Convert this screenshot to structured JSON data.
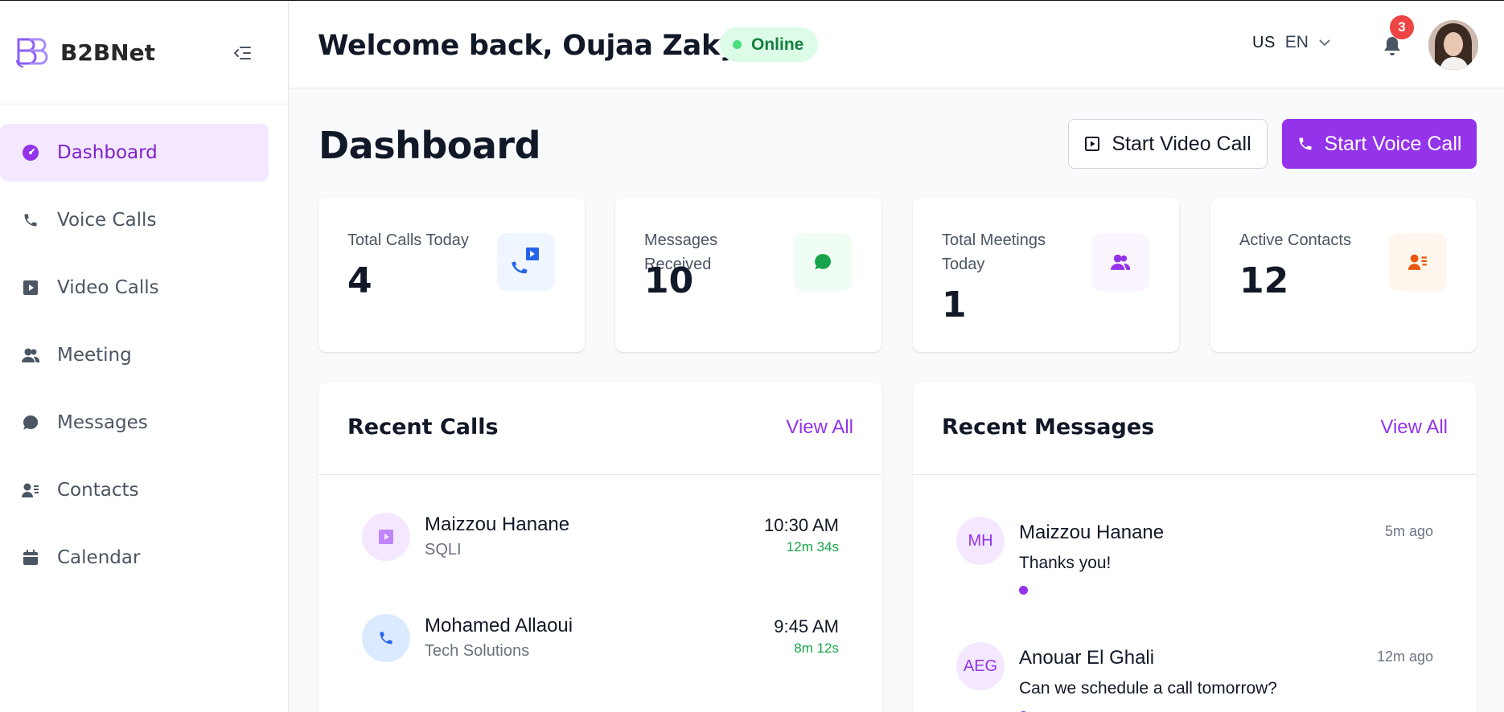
{
  "sidebar": {
    "brand": "B2BNet",
    "items": [
      {
        "label": "Dashboard",
        "icon": "dashboard-icon",
        "active": true
      },
      {
        "label": "Voice Calls",
        "icon": "phone-icon"
      },
      {
        "label": "Video Calls",
        "icon": "video-icon"
      },
      {
        "label": "Meeting",
        "icon": "users-icon"
      },
      {
        "label": "Messages",
        "icon": "chat-icon"
      },
      {
        "label": "Contacts",
        "icon": "contacts-icon"
      },
      {
        "label": "Calendar",
        "icon": "calendar-icon"
      }
    ]
  },
  "header": {
    "welcome": "Welcome back, Oujaa Zakya",
    "status": "Online",
    "lang_flag": "US",
    "lang_code": "EN",
    "notifications": "3"
  },
  "main": {
    "title": "Dashboard",
    "video_button": "Start Video Call",
    "voice_button": "Start Voice Call"
  },
  "stats": [
    {
      "label": "Total Calls Today",
      "value": "4"
    },
    {
      "label": "Messages Received",
      "value": "10"
    },
    {
      "label": "Total Meetings Today",
      "value": "1"
    },
    {
      "label": "Active Contacts",
      "value": "12"
    }
  ],
  "recent_calls": {
    "title": "Recent Calls",
    "view_all": "View All",
    "rows": [
      {
        "name": "Maizzou Hanane",
        "company": "SQLI",
        "time": "10:30 AM",
        "duration": "12m 34s",
        "type": "video"
      },
      {
        "name": "Mohamed Allaoui",
        "company": "Tech Solutions",
        "time": "9:45 AM",
        "duration": "8m 12s",
        "type": "voice"
      }
    ]
  },
  "recent_messages": {
    "title": "Recent Messages",
    "view_all": "View All",
    "rows": [
      {
        "initials": "MH",
        "name": "Maizzou Hanane",
        "text": "Thanks you!",
        "ago": "5m ago"
      },
      {
        "initials": "AEG",
        "name": "Anouar El Ghali",
        "text": "Can we schedule a call tomorrow?",
        "ago": "12m ago"
      }
    ]
  },
  "colors": {
    "accent": "#9333ea",
    "active_bg": "#f3e8ff",
    "online": "#15803d",
    "badge": "#ef4444"
  }
}
